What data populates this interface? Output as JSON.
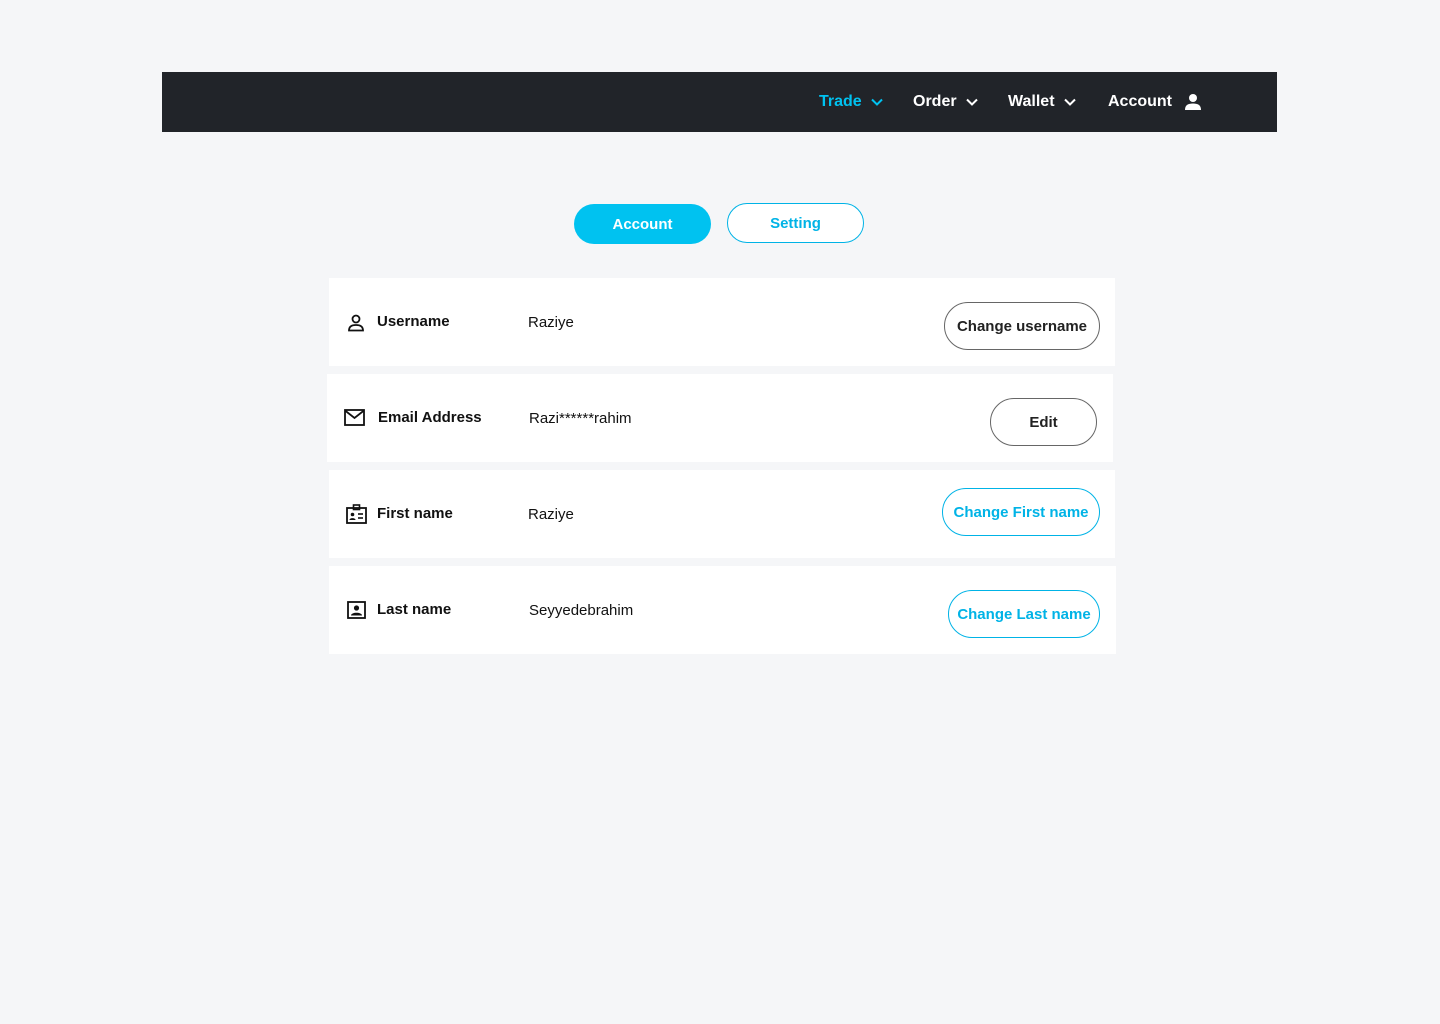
{
  "nav": {
    "items": [
      {
        "label": "Trade",
        "icon": "chevron-down-icon",
        "active": true
      },
      {
        "label": "Order",
        "icon": "chevron-down-icon"
      },
      {
        "label": "Wallet",
        "icon": "chevron-down-icon"
      },
      {
        "label": "Account",
        "icon": "user-icon"
      }
    ],
    "accent_color": "#00c2f0",
    "bar_color": "#212429"
  },
  "tabs": [
    {
      "label": "Account",
      "selected": true
    },
    {
      "label": "Setting",
      "selected": false
    }
  ],
  "rows": [
    {
      "icon": "user-icon",
      "label": "Username",
      "value": "Raziye",
      "button": "Change username"
    },
    {
      "icon": "mail-icon",
      "label": "Email Address",
      "value": "Razi******rahim",
      "button": "Edit"
    },
    {
      "icon": "id-card-icon",
      "label": "First name",
      "value": "Raziye",
      "button": "Change First name"
    },
    {
      "icon": "contact-icon",
      "label": "Last name",
      "value": "Seyyedebrahim",
      "button": "Change Last name"
    }
  ]
}
